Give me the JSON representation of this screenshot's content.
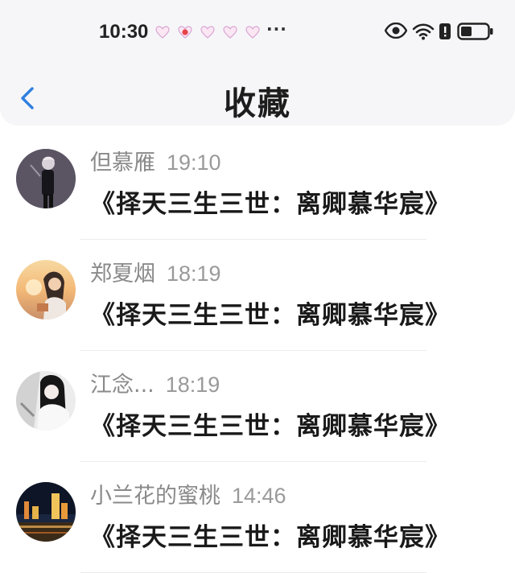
{
  "status_bar": {
    "time": "10:30",
    "more": "···",
    "notification_icons": [
      "heart-notification-icon",
      "heart-badge-notification-icon",
      "heart-notification-icon",
      "heart-notification-icon",
      "heart-notification-icon"
    ],
    "system_icons": [
      "eye-icon",
      "wifi-icon",
      "alert-icon",
      "battery-icon"
    ]
  },
  "nav": {
    "back_icon": "chevron-left-icon",
    "title": "收藏"
  },
  "colors": {
    "accent": "#2f7fe0",
    "name_gray": "#8a8a8a",
    "content_dark": "#1a1a1a"
  },
  "items": [
    {
      "name": "但慕雁",
      "time": "19:10",
      "content": "《择天三生三世：离卿慕华宸》",
      "avatar": "avatar-dark-figure"
    },
    {
      "name": "郑夏烟",
      "time": "18:19",
      "content": "《择天三生三世：离卿慕华宸》",
      "avatar": "avatar-sunset-girl"
    },
    {
      "name": "江念...",
      "time": "18:19",
      "content": "《择天三生三世：离卿慕华宸》",
      "avatar": "avatar-bw-girl"
    },
    {
      "name": "小兰花的蜜桃",
      "time": "14:46",
      "content": "《择天三生三世：离卿慕华宸》",
      "avatar": "avatar-night-city"
    }
  ]
}
